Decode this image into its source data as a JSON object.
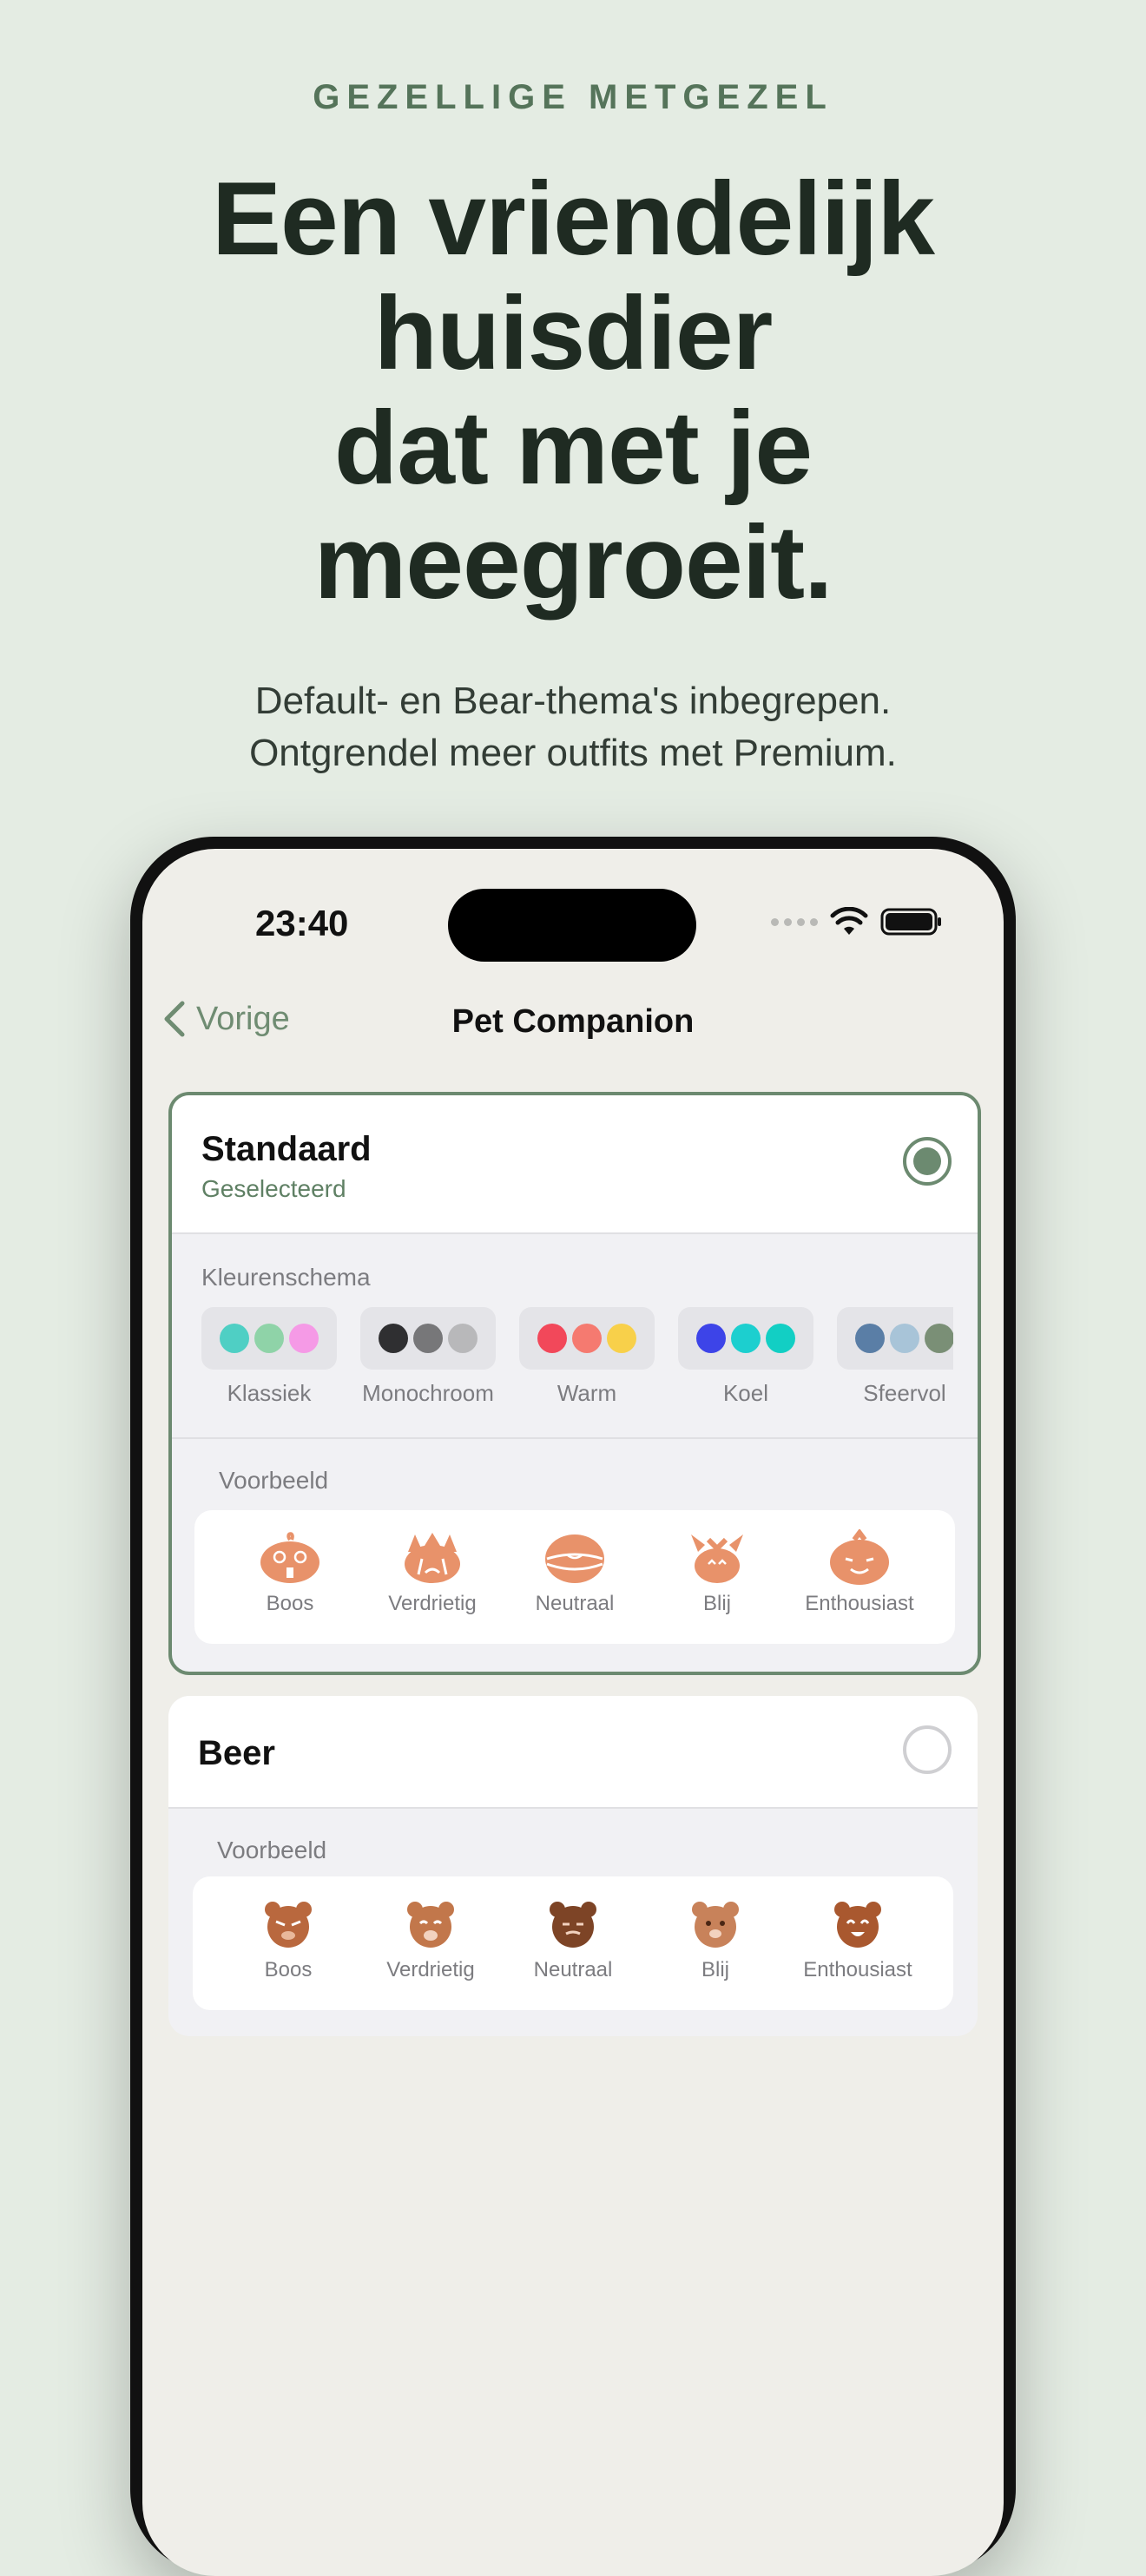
{
  "promo": {
    "eyebrow": "GEZELLIGE METGEZEL",
    "headline_lines": [
      "Een vriendelijk",
      "huisdier",
      "dat met je",
      "meegroeit."
    ],
    "subtitle_lines": [
      "Default- en Bear-thema's inbegrepen.",
      "Ontgrendel meer outfits met Premium."
    ]
  },
  "status_bar": {
    "time": "23:40"
  },
  "nav": {
    "back_label": "Vorige",
    "title": "Pet Companion"
  },
  "themes": [
    {
      "name": "Standaard",
      "status": "Geselecteerd",
      "selected": true,
      "color_scheme_label": "Kleurenschema",
      "color_schemes": [
        {
          "name": "Klassiek",
          "colors": [
            "#4fcfc4",
            "#8fd3a8",
            "#f59ae6"
          ]
        },
        {
          "name": "Monochroom",
          "colors": [
            "#2f2f31",
            "#777779",
            "#b8b8ba"
          ]
        },
        {
          "name": "Warm",
          "colors": [
            "#f2485a",
            "#f57a70",
            "#f8d04a"
          ]
        },
        {
          "name": "Koel",
          "colors": [
            "#3d44e8",
            "#1ccfcf",
            "#12cfc4"
          ]
        },
        {
          "name": "Sfeervol",
          "colors": [
            "#5a7ea6",
            "#a8c4d8",
            "#7a8f76"
          ]
        }
      ],
      "preview_label": "Voorbeeld",
      "moods": [
        "Boos",
        "Verdrietig",
        "Neutraal",
        "Blij",
        "Enthousiast"
      ]
    },
    {
      "name": "Beer",
      "selected": false,
      "preview_label": "Voorbeeld",
      "moods": [
        "Boos",
        "Verdrietig",
        "Neutraal",
        "Blij",
        "Enthousiast"
      ]
    }
  ],
  "colors": {
    "accent": "#6c8a70",
    "background": "#e4ece3",
    "pet_orange": "#e8926a",
    "bear_brown": "#b9683e"
  }
}
